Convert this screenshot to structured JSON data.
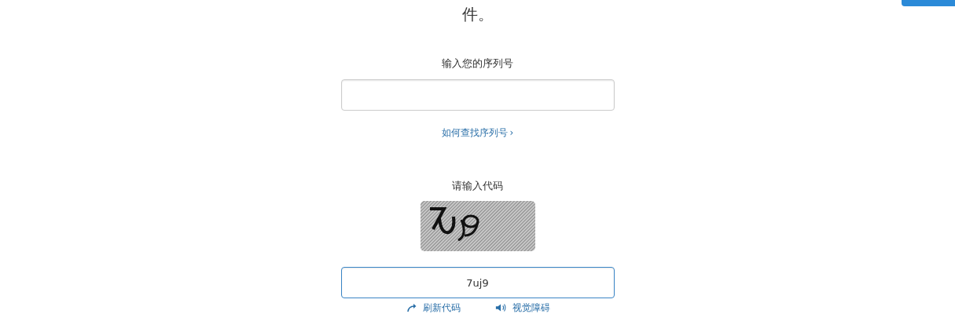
{
  "intro_tail": "件。",
  "serial": {
    "label": "输入您的序列号",
    "link": "如何查找序列号",
    "link_arrow": "›"
  },
  "captcha": {
    "label": "请输入代码",
    "value": "7uj9",
    "focused": true,
    "actions": [
      {
        "kind": "refresh",
        "label": "刷新代码"
      },
      {
        "kind": "audio",
        "label": "视觉障碍"
      }
    ]
  }
}
